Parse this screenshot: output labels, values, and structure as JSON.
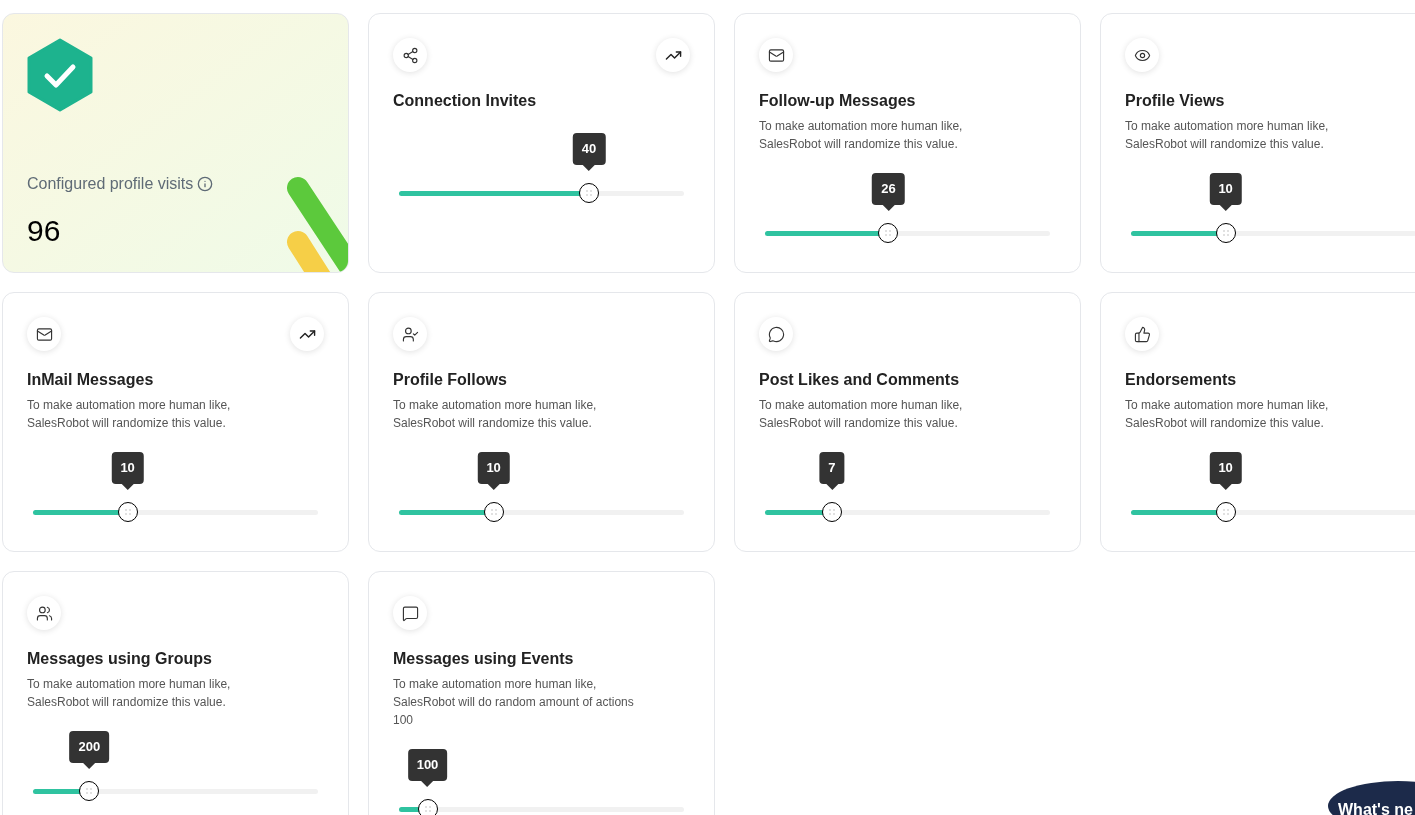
{
  "cards": [
    {
      "kind": "stat",
      "label": "Configured profile visits",
      "value": "96"
    },
    {
      "kind": "slider",
      "title": "Connection Invites",
      "trend": true,
      "value": "40",
      "level": 0.667
    },
    {
      "kind": "slider",
      "title": "Follow-up Messages",
      "trend": false,
      "description": [
        "To make automation more human like,",
        "SalesRobot will randomize this value."
      ],
      "value": "26",
      "level": 0.433
    },
    {
      "kind": "slider",
      "title": "Profile Views",
      "trend": false,
      "description": [
        "To make automation more human like,",
        "SalesRobot will randomize this value."
      ],
      "value": "10",
      "level": 0.332
    },
    {
      "kind": "slider",
      "title": "InMail Messages",
      "trend": true,
      "description": [
        "To make automation more human like,",
        "SalesRobot will randomize this value."
      ],
      "value": "10",
      "level": 0.332
    },
    {
      "kind": "slider",
      "title": "Profile Follows",
      "trend": false,
      "description": [
        "To make automation more human like,",
        "SalesRobot will randomize this value."
      ],
      "value": "10",
      "level": 0.332
    },
    {
      "kind": "slider",
      "title": "Post Likes and Comments",
      "trend": false,
      "description": [
        "To make automation more human like,",
        "SalesRobot will randomize this value."
      ],
      "value": "7",
      "level": 0.235
    },
    {
      "kind": "slider",
      "title": "Endorsements",
      "trend": false,
      "description": [
        "To make automation more human like,",
        "SalesRobot will randomize this value."
      ],
      "value": "10",
      "level": 0.332
    },
    {
      "kind": "slider",
      "title": "Messages using Groups",
      "trend": false,
      "description": [
        "To make automation more human like,",
        "SalesRobot will randomize this value."
      ],
      "value": "200",
      "level": 0.198
    },
    {
      "kind": "slider",
      "title": "Messages using Events",
      "trend": false,
      "description": [
        "To make automation more human like,",
        "SalesRobot will do random amount of actions",
        "100"
      ],
      "value": "100",
      "level": 0.1
    }
  ],
  "whats_new": "What's ne"
}
